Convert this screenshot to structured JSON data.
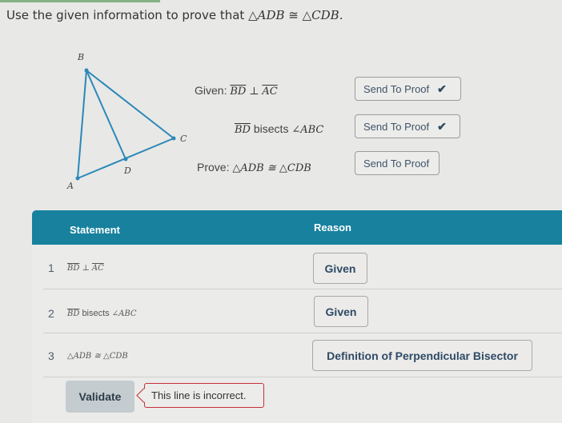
{
  "instruction": {
    "text": "Use the given information to prove that",
    "math_left": "△ADB",
    "congruent": "≅",
    "math_right": "△CDB."
  },
  "diagram": {
    "points": [
      "B",
      "C",
      "D",
      "A"
    ],
    "line_color": "#2b88b8"
  },
  "givens": [
    {
      "prefix": "Given:",
      "seg1": "BD",
      "rel": "⊥",
      "seg2": "AC",
      "button": "Send To Proof",
      "sent": true
    },
    {
      "prefix": "",
      "seg1": "BD",
      "rel": "bisects",
      "angle": "∠ABC",
      "button": "Send To Proof",
      "sent": true
    },
    {
      "prefix": "Prove:",
      "expr": "△ADB ≅ △CDB",
      "button": "Send To Proof",
      "sent": false
    }
  ],
  "check_icon": "✔",
  "table": {
    "header_color": "#17819e",
    "headers": {
      "statement": "Statement",
      "reason": "Reason"
    },
    "rows": [
      {
        "num": "1",
        "seg1": "BD",
        "rel": "⊥",
        "seg2": "AC",
        "reason": "Given"
      },
      {
        "num": "2",
        "seg1": "BD",
        "rel": "bisects",
        "angle": "∠ABC",
        "reason": "Given"
      },
      {
        "num": "3",
        "expr": "△ADB ≅ △CDB",
        "reason": "Definition of Perpendicular Bisector"
      }
    ]
  },
  "validate": {
    "label": "Validate",
    "error_message": "This line is incorrect.",
    "error_color": "#c4303c"
  }
}
